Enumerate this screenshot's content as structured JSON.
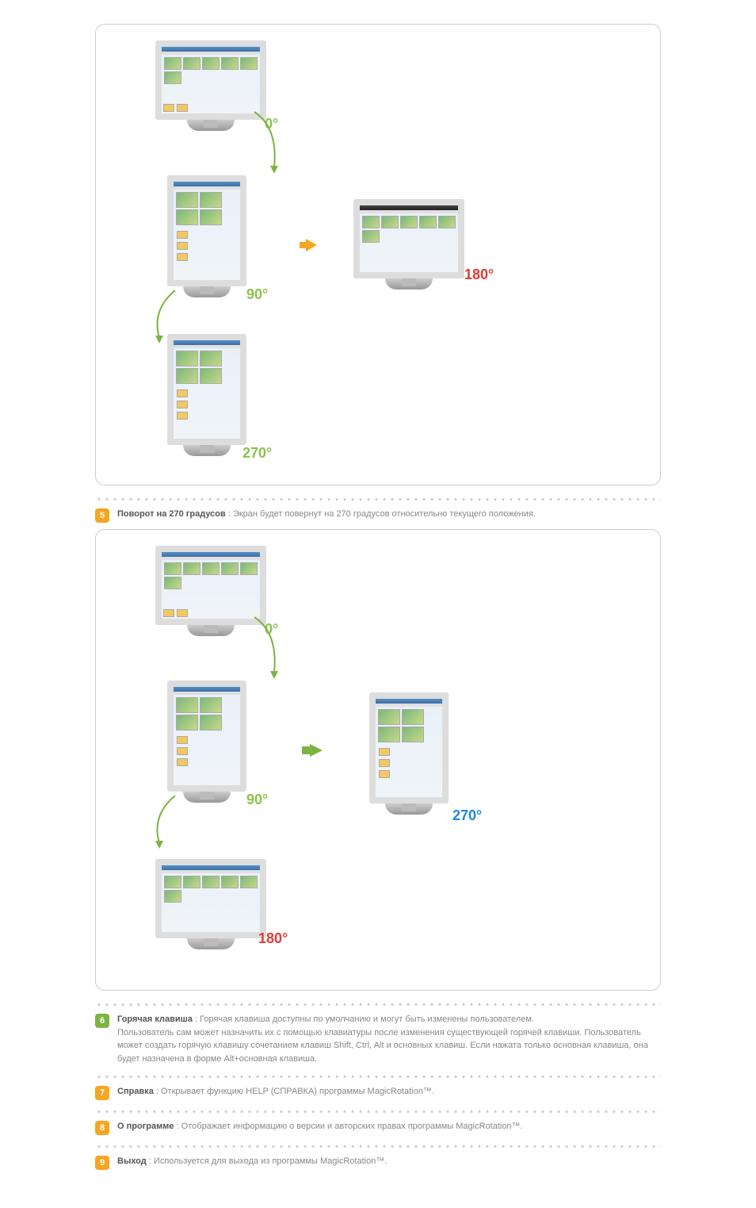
{
  "items": {
    "item5": {
      "badge": "5",
      "title": "Поворот на 270 градусов",
      "text": " : Экран будет повернут на 270 градусов относительно текущего положения."
    },
    "item6": {
      "badge": "6",
      "title": "Горячая клавиша",
      "text1": " : Горячая клавиша доступны по умолчанию и могут быть изменены пользователем.",
      "text2": "Пользователь сам может назначить их с помощью клавиатуры после изменения существующей горячей клавиши. Пользователь может создать горячую клавишу сочетанием клавиш Shift, Ctrl, Alt и основных клавиш. Если нажата только основная клавиша, она будет назначена в форме Alt+основная клавиша."
    },
    "item7": {
      "badge": "7",
      "title": "Справка",
      "text": " : Открывает функцию HELP (СПРАВКА) программы MagicRotation™."
    },
    "item8": {
      "badge": "8",
      "title": "О программе",
      "text": " : Отображает информацию о версии и авторских правах программы MagicRotation™."
    },
    "item9": {
      "badge": "9",
      "title": "Выход",
      "text": " : Используется для выхода из программы MagicRotation™."
    }
  },
  "labels": {
    "deg0": "0°",
    "deg90": "90°",
    "deg180": "180°",
    "deg270": "270°"
  }
}
